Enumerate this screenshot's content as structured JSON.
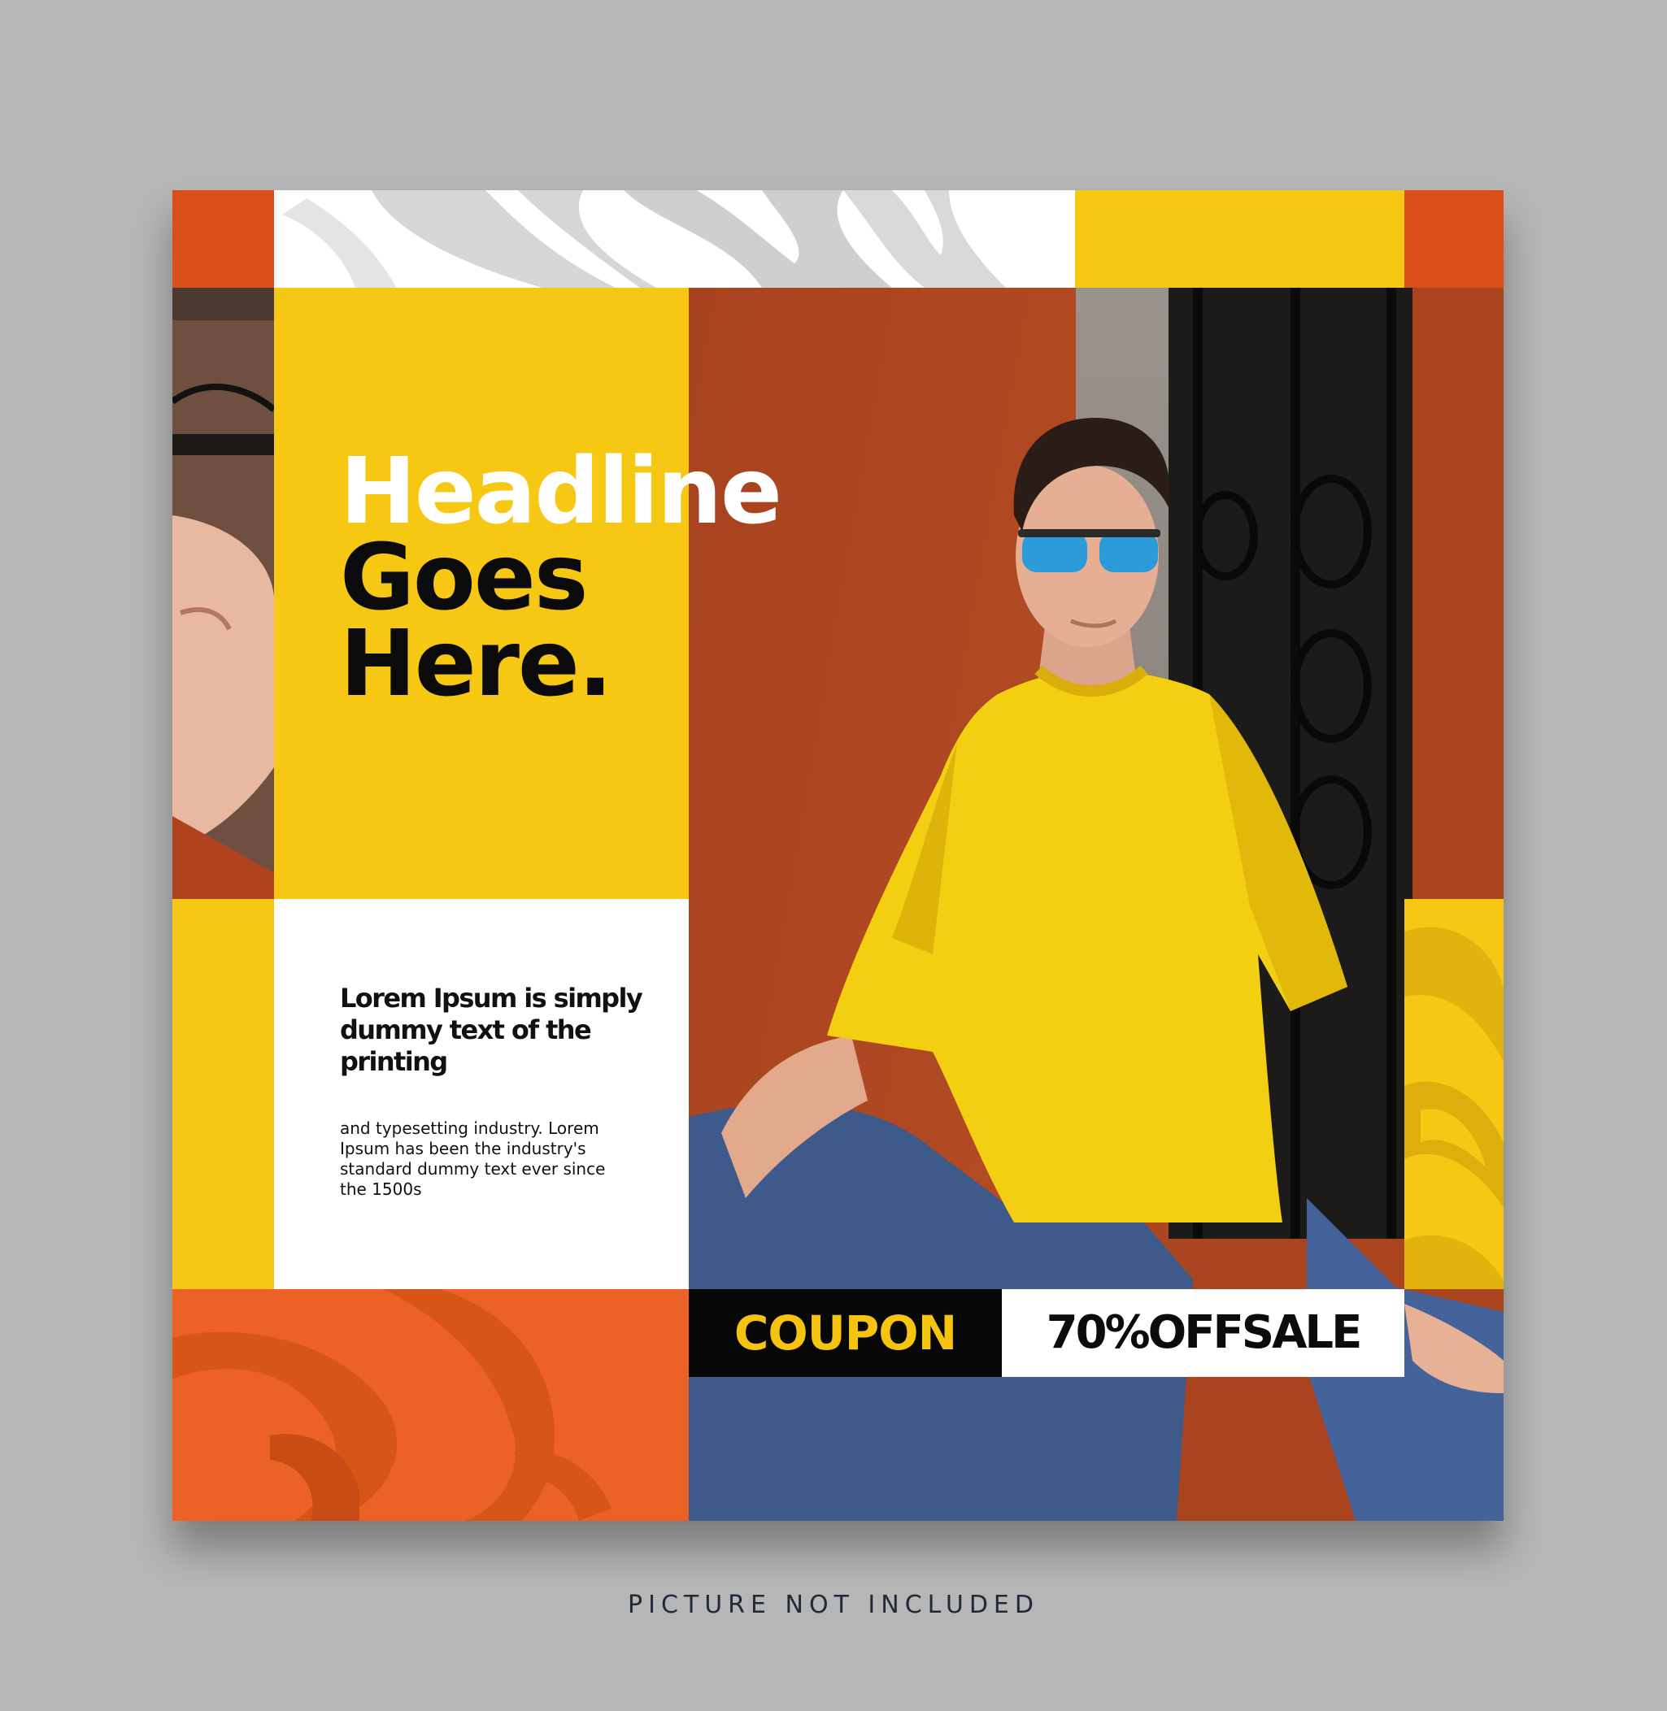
{
  "post": {
    "headline": {
      "line1": "Headline",
      "line2": "Goes",
      "line3": "Here."
    },
    "intro": "Lorem Ipsum is simply dummy text of the printing",
    "body": "and typesetting industry. Lorem Ipsum has been the industry's standard dummy text ever since the 1500s",
    "coupon": {
      "label": "COUPON",
      "offer": "70%OFFSALE"
    }
  },
  "caption": "PICTURE NOT INCLUDED",
  "colors": {
    "page_background": "#b6b6b6",
    "brand_orange": "#d94f17",
    "accent_yellow": "#f6c814",
    "light_orange": "#ec6125",
    "coupon_black": "#070707",
    "coupon_yellow_text": "#f6c30f",
    "white": "#ffffff",
    "caption_text": "#1f2a36"
  }
}
